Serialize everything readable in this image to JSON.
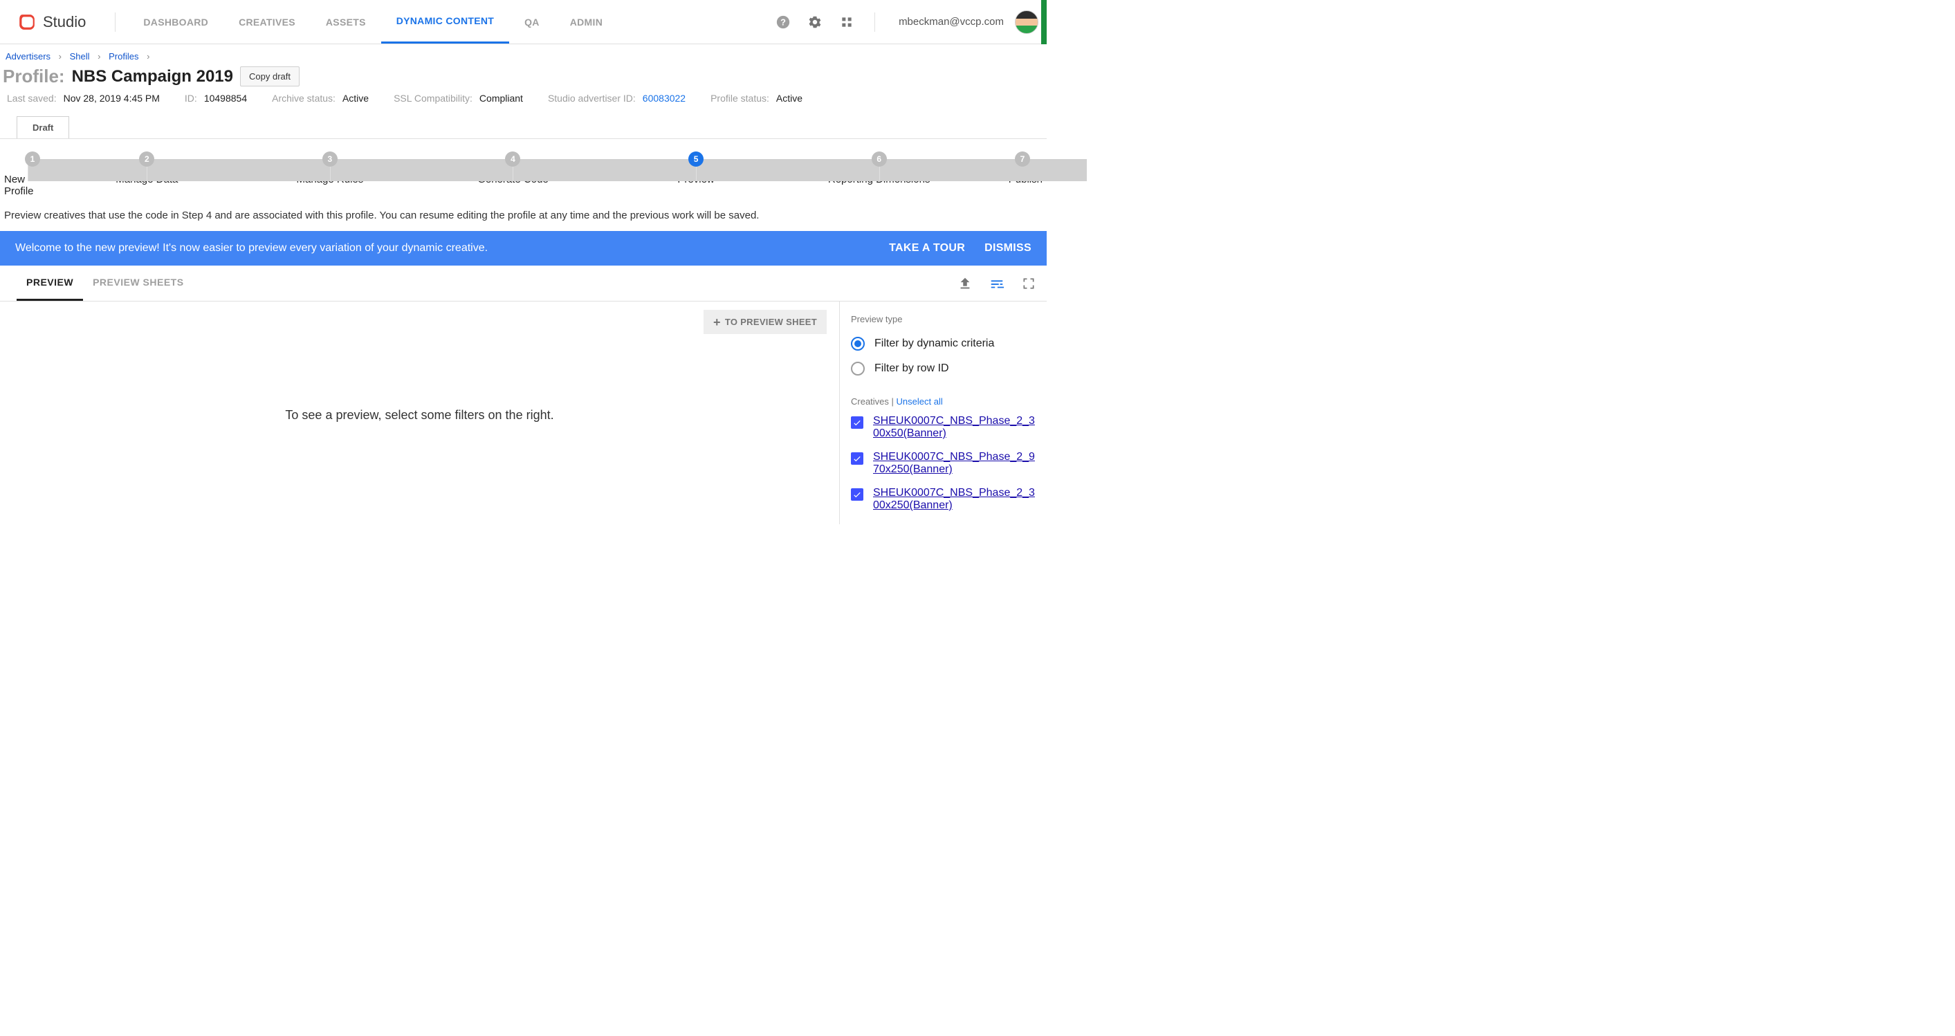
{
  "brand": "Studio",
  "nav": [
    {
      "label": "DASHBOARD",
      "active": false
    },
    {
      "label": "CREATIVES",
      "active": false
    },
    {
      "label": "ASSETS",
      "active": false
    },
    {
      "label": "DYNAMIC CONTENT",
      "active": true
    },
    {
      "label": "QA",
      "active": false
    },
    {
      "label": "ADMIN",
      "active": false
    }
  ],
  "user_email": "mbeckman@vccp.com",
  "breadcrumbs": [
    {
      "label": "Advertisers"
    },
    {
      "label": "Shell"
    },
    {
      "label": "Profiles"
    }
  ],
  "profile": {
    "prefix": "Profile:",
    "name": "NBS Campaign 2019",
    "copy_label": "Copy draft"
  },
  "meta": {
    "last_saved_label": "Last saved:",
    "last_saved": "Nov 28, 2019 4:45 PM",
    "id_label": "ID:",
    "id": "10498854",
    "archive_label": "Archive status:",
    "archive": "Active",
    "ssl_label": "SSL Compatibility:",
    "ssl": "Compliant",
    "advertiser_id_label": "Studio advertiser ID:",
    "advertiser_id": "60083022",
    "profile_status_label": "Profile status:",
    "profile_status": "Active"
  },
  "draft_tab": "Draft",
  "steps": [
    {
      "n": "1",
      "label": "New Profile"
    },
    {
      "n": "2",
      "label": "Manage Data"
    },
    {
      "n": "3",
      "label": "Manage Rules"
    },
    {
      "n": "4",
      "label": "Generate Code"
    },
    {
      "n": "5",
      "label": "Preview",
      "active": true
    },
    {
      "n": "6",
      "label": "Reporting Dimensions"
    },
    {
      "n": "7",
      "label": "Publish"
    }
  ],
  "hint": "Preview creatives that use the code in Step 4 and are associated with this profile. You can resume editing the profile at any time and the previous work will be saved.",
  "banner": {
    "msg": "Welcome to the new preview! It's now easier to preview every variation of your dynamic creative.",
    "tour": "TAKE A TOUR",
    "dismiss": "DISMISS"
  },
  "tabs": {
    "preview": "PREVIEW",
    "sheets": "PREVIEW SHEETS"
  },
  "to_sheet": "TO PREVIEW SHEET",
  "left_msg": "To see a preview, select some filters on the right.",
  "side": {
    "preview_type_label": "Preview type",
    "radio1": "Filter by dynamic criteria",
    "radio2": "Filter by row ID",
    "creatives_label": "Creatives",
    "unselect": "Unselect all",
    "creatives": [
      "SHEUK0007C_NBS_Phase_2_300x50(Banner)",
      "SHEUK0007C_NBS_Phase_2_970x250(Banner)",
      "SHEUK0007C_NBS_Phase_2_300x250(Banner)"
    ]
  }
}
